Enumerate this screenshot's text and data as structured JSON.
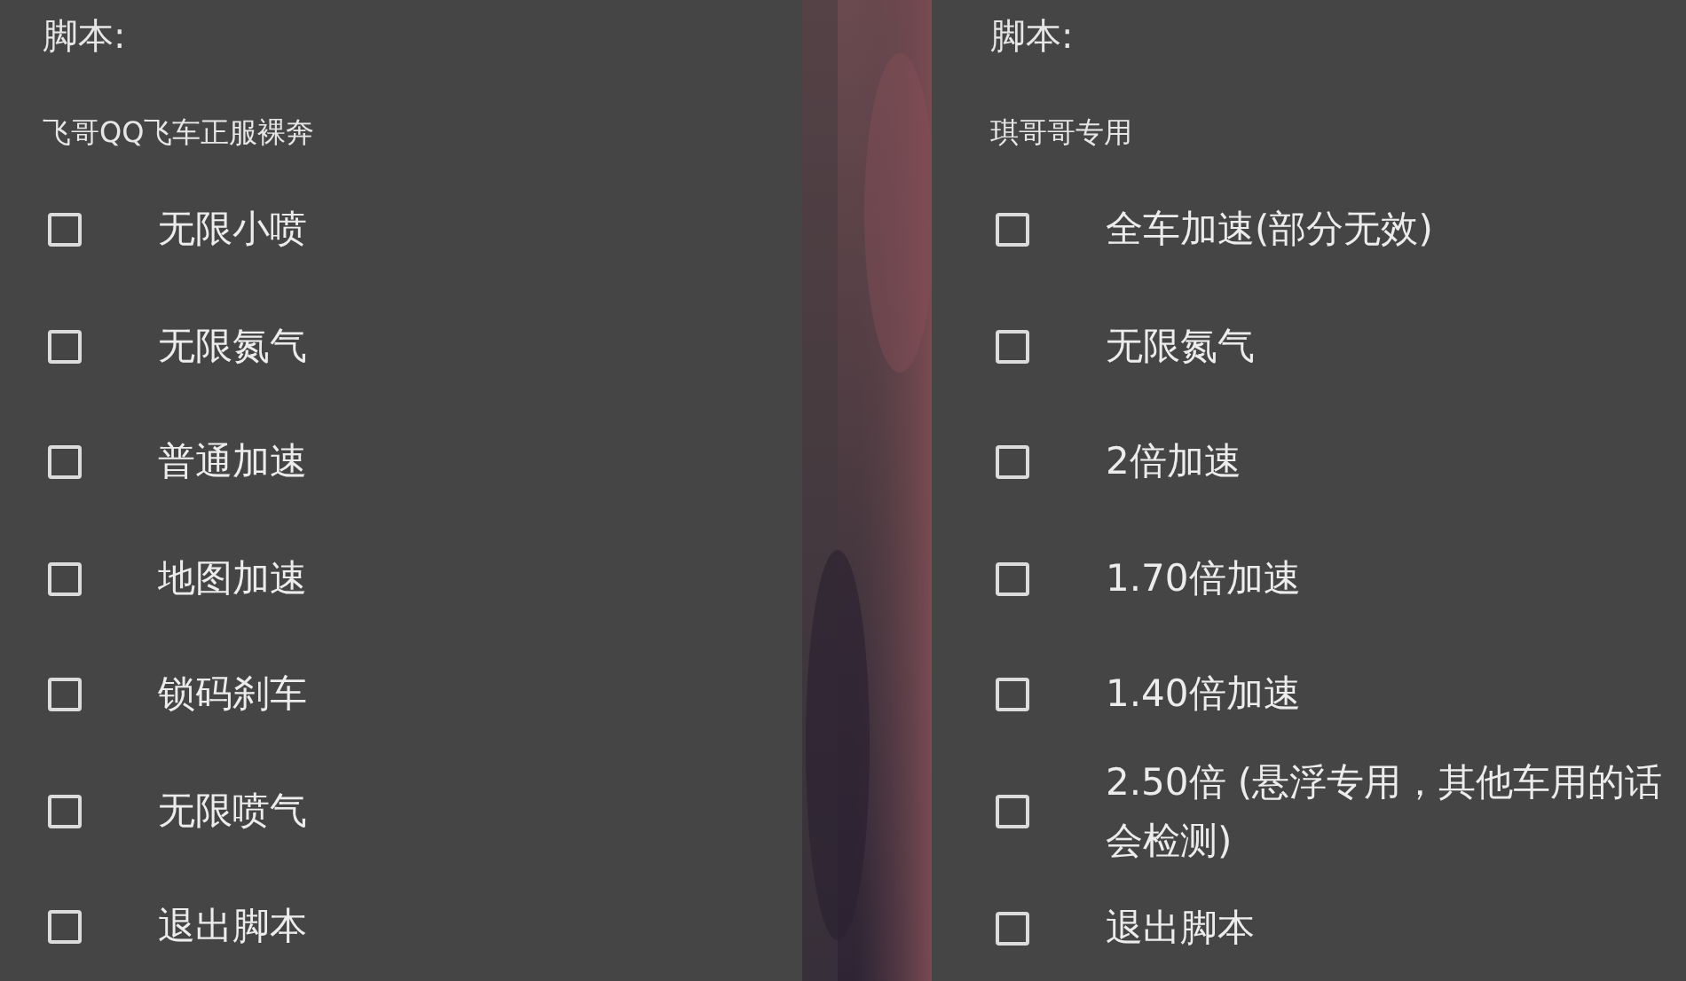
{
  "panels": [
    {
      "heading": "脚本:",
      "subtitle": "飞哥QQ飞车正服裸奔",
      "options": [
        {
          "label": "无限小喷",
          "checked": false
        },
        {
          "label": "无限氮气",
          "checked": false
        },
        {
          "label": "普通加速",
          "checked": false
        },
        {
          "label": "地图加速",
          "checked": false
        },
        {
          "label": "锁码刹车",
          "checked": false
        },
        {
          "label": "无限喷气",
          "checked": false
        },
        {
          "label": "退出脚本",
          "checked": false
        }
      ]
    },
    {
      "heading": "脚本:",
      "subtitle": "琪哥哥专用",
      "options": [
        {
          "label": "全车加速(部分无效)",
          "checked": false
        },
        {
          "label": "无限氮气",
          "checked": false
        },
        {
          "label": "2倍加速",
          "checked": false
        },
        {
          "label": "1.70倍加速",
          "checked": false
        },
        {
          "label": "1.40倍加速",
          "checked": false
        },
        {
          "label": "2.50倍 (悬浮专用，其他车用的话会检测)",
          "checked": false
        },
        {
          "label": "退出脚本",
          "checked": false
        }
      ]
    }
  ]
}
